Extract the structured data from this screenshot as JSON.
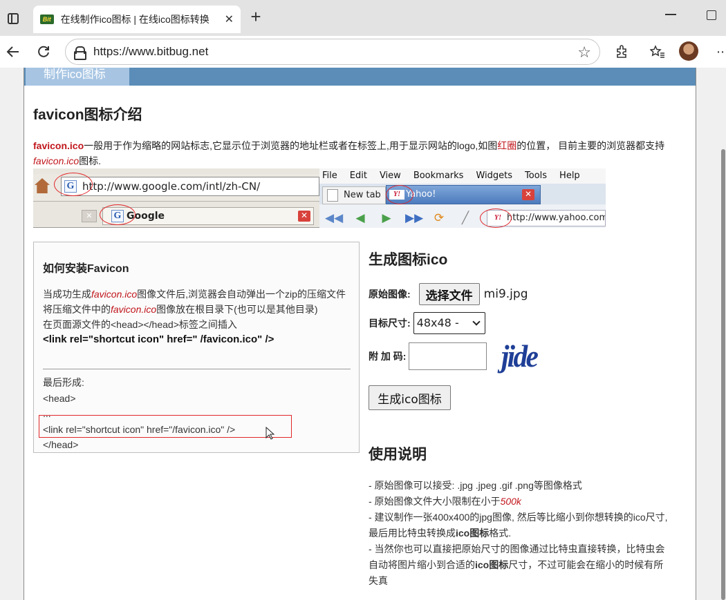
{
  "browser": {
    "tab_title": "在线制作ico图标 | 在线ico图标转换",
    "tab_favicon_text": "Bit",
    "url": "https://www.bitbug.net"
  },
  "nav": {
    "active_tab": "制作ico图标"
  },
  "intro": {
    "heading": "favicon图标介绍",
    "term": "favicon.ico",
    "text1": "一般用于作为缩略的网站标志,它显示位于浏览器的地址栏或者在标签上,用于显示网站的logo,如图",
    "red_circle": "红圈",
    "text2": "的位置， 主要的浏览器都支持",
    "text2_lead": "的位置，  目前主要的浏览器都支持",
    "term_italic": "favicon.ico",
    "text3": "图标."
  },
  "demo": {
    "address_url": "http://www.google.com/intl/zh-CN/",
    "google_tab": "Google",
    "menu": [
      "File",
      "Edit",
      "View",
      "Bookmarks",
      "Widgets",
      "Tools",
      "Help"
    ],
    "newtab": "New tab",
    "yahoo_tab": "Yahoo!",
    "yahoo_url": "http://www.yahoo.com"
  },
  "install": {
    "heading": "如何安装Favicon",
    "line1_a": "当成功生成",
    "line1_term": "favicon.ico",
    "line1_b": "图像文件后,浏览器会自动弹出一个zip的压缩文件",
    "line2_a": "将压缩文件中的",
    "line2_term": "favicon.ico",
    "line2_b": "图像放在根目录下(也可以是其他目录)",
    "line3": "在页面源文件的<head></head>标签之间插入",
    "code": "<link rel=\"shortcut icon\" href=\" /favicon.ico\" />",
    "final_label": "最后形成:",
    "final_head_open": "<head>",
    "final_dots": "...",
    "final_link": "<link rel=\"shortcut icon\" href=\"/favicon.ico\" />",
    "final_head_close": "</head>"
  },
  "generator": {
    "heading": "生成图标ico",
    "source_label": "原始图像:",
    "choose_file": "选择文件",
    "file_name": "mi9.jpg",
    "size_label": "目标尺寸:",
    "size_value": "48x48 -",
    "code_label": "附 加 码:",
    "captcha": "jide",
    "submit": "生成ico图标"
  },
  "usage": {
    "heading": "使用说明",
    "item1": "- 原始图像可以接受: .jpg .jpeg .gif .png等图像格式",
    "item2_a": "- 原始图像文件大小限制在小于",
    "item2_limit": "500k",
    "item3_a": "- 建议制作一张400x400的jpg图像, 然后等比缩小到你想转换的ico尺寸,最后用比特虫转换成",
    "item3_bold": "ico图标",
    "item3_b": "格式.",
    "item4_a": "- 当然你也可以直接把原始尺寸的图像通过比特虫直接转换，比特虫会自动将图片缩小到合适的",
    "item4_bold": "ico图标",
    "item4_b": "尺寸，不过可能会在缩小的时候有所失真"
  }
}
